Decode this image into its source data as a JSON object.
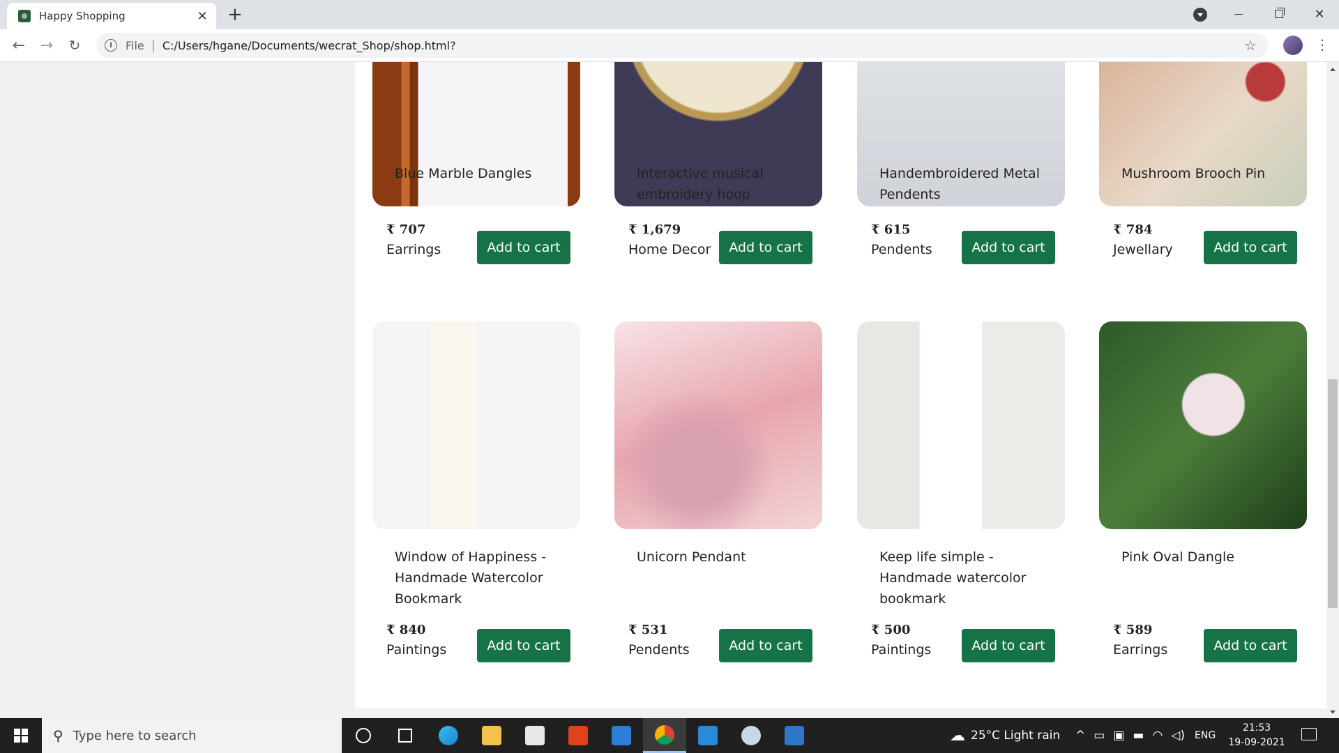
{
  "browser": {
    "tab_title": "Happy Shopping",
    "tab_close": "✕",
    "new_tab": "+",
    "address_scheme_label": "File",
    "url": "C:/Users/hgane/Documents/wecrat_Shop/shop.html?"
  },
  "products": [
    {
      "name": "Blue Marble Dangles",
      "price": "₹ 707",
      "category": "Earrings",
      "button": "Add to cart"
    },
    {
      "name": "Interactive musical embroidery hoop",
      "price": "₹ 1,679",
      "category": "Home Decor",
      "button": "Add to cart"
    },
    {
      "name": "Handembroidered Metal Pendents",
      "price": "₹ 615",
      "category": "Pendents",
      "button": "Add to cart"
    },
    {
      "name": "Mushroom Brooch Pin",
      "price": "₹ 784",
      "category": "Jewellary",
      "button": "Add to cart"
    },
    {
      "name": "Window of Happiness - Handmade Watercolor Bookmark",
      "price": "₹ 840",
      "category": "Paintings",
      "button": "Add to cart"
    },
    {
      "name": "Unicorn Pendant",
      "price": "₹ 531",
      "category": "Pendents",
      "button": "Add to cart"
    },
    {
      "name": "Keep life simple - Handmade watercolor bookmark",
      "price": "₹ 500",
      "category": "Paintings",
      "button": "Add to cart"
    },
    {
      "name": "Pink Oval Dangle",
      "price": "₹ 589",
      "category": "Earrings",
      "button": "Add to cart"
    }
  ],
  "taskbar": {
    "search_placeholder": "Type here to search",
    "weather": "25°C  Light rain",
    "language": "ENG",
    "time": "21:53",
    "date": "19-09-2021"
  },
  "colors": {
    "button_green": "#157347",
    "taskbar_bg": "#202020"
  }
}
